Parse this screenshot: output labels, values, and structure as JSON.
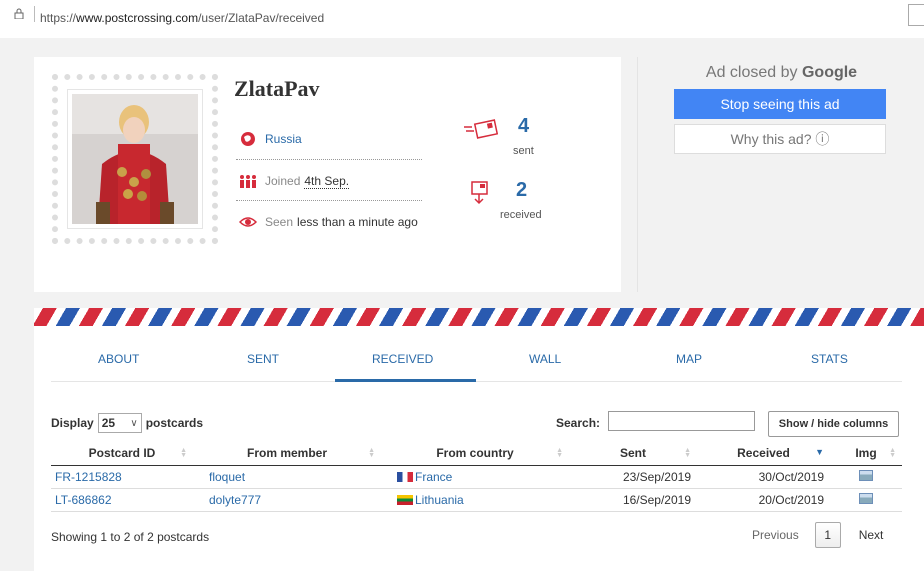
{
  "browser": {
    "url_prefix": "https://",
    "url_host": "www.postcrossing.com",
    "url_path": "/user/ZlataPav/received"
  },
  "profile": {
    "username": "ZlataPav",
    "country": "Russia",
    "joined_label": "Joined",
    "joined_date": "4th Sep.",
    "seen_label": "Seen",
    "seen_value": "less than a minute ago",
    "sent_count": "4",
    "sent_label": "sent",
    "received_count": "2",
    "received_label": "received"
  },
  "ad": {
    "closed_by": "Ad closed by",
    "brand": "Google",
    "stop_label": "Stop seeing this ad",
    "why_label": "Why this ad? ⓘ"
  },
  "tabs": [
    "ABOUT",
    "SENT",
    "RECEIVED",
    "WALL",
    "MAP",
    "STATS"
  ],
  "active_tab": "RECEIVED",
  "table_controls": {
    "display_label": "Display",
    "display_value": "25",
    "display_suffix": "postcards",
    "search_label": "Search:",
    "search_value": "",
    "columns_button": "Show / hide columns"
  },
  "table": {
    "headers": [
      "Postcard ID",
      "From member",
      "From country",
      "Sent",
      "Received",
      "Img"
    ],
    "rows": [
      {
        "id": "FR-1215828",
        "member": "floquet",
        "country": "France",
        "flag": "france",
        "sent": "23/Sep/2019",
        "received": "30/Oct/2019"
      },
      {
        "id": "LT-686862",
        "member": "dolyte777",
        "country": "Lithuania",
        "flag": "lithuania",
        "sent": "16/Sep/2019",
        "received": "20/Oct/2019"
      }
    ]
  },
  "footer": {
    "showing": "Showing 1 to 2 of 2 postcards",
    "previous": "Previous",
    "page": "1",
    "next": "Next"
  },
  "colors": {
    "link": "#2a6aa8",
    "accent_red": "#d62c3c",
    "google_blue": "#4285f4"
  }
}
